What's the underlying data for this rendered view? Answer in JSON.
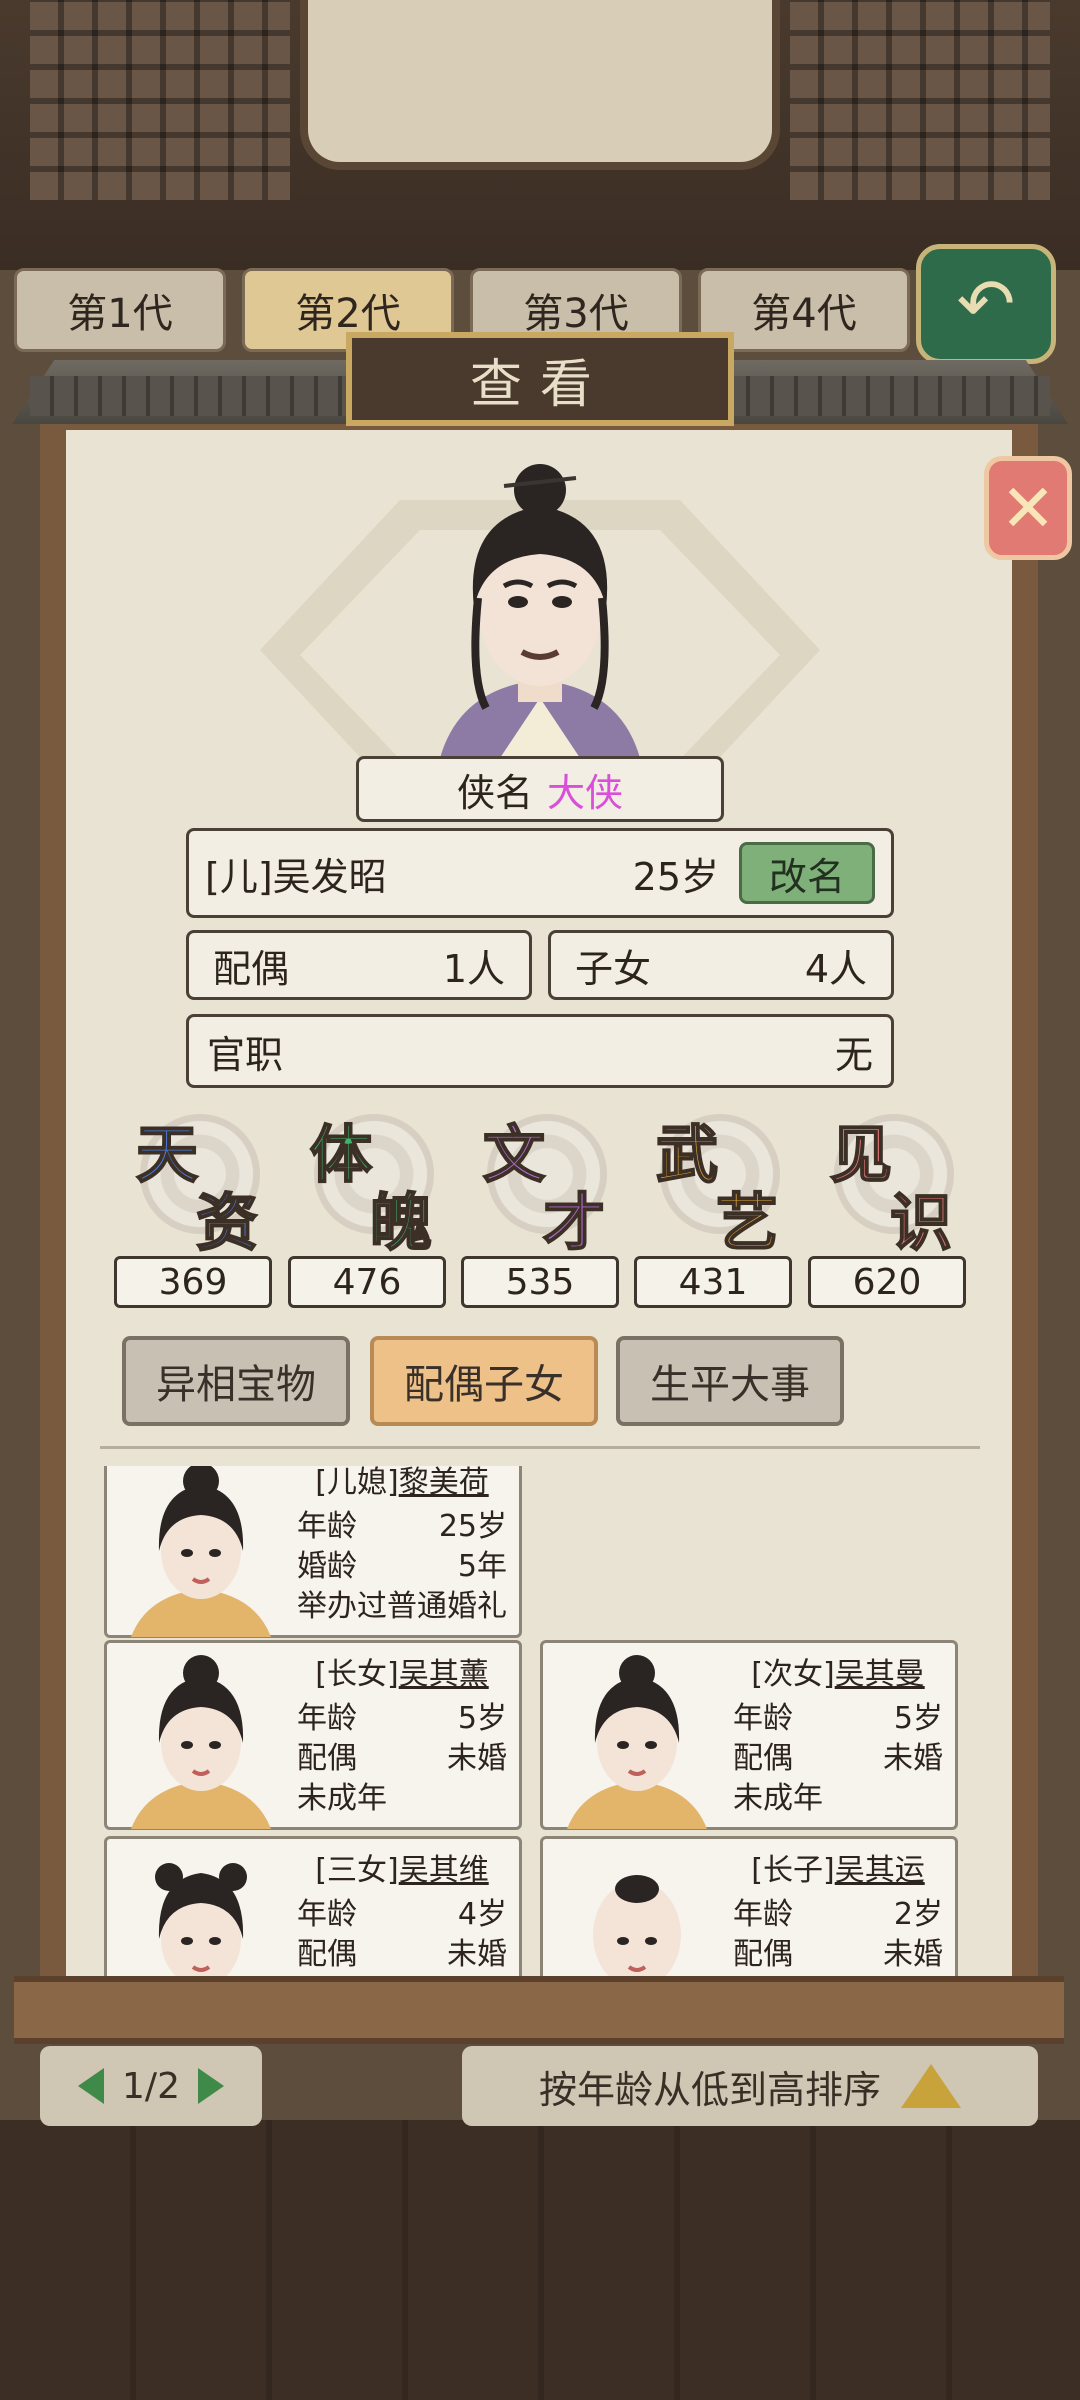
{
  "generation_tabs": [
    "第1代",
    "第2代",
    "第3代",
    "第4代"
  ],
  "dialog_title": "查看",
  "profile": {
    "title_label": "侠名",
    "title_value": "大侠",
    "name": "[儿]吴发昭",
    "age": "25岁",
    "rename_label": "改名",
    "spouse_label": "配偶",
    "spouse_value": "1人",
    "children_label": "子女",
    "children_value": "4人",
    "office_label": "官职",
    "office_value": "无"
  },
  "attributes": [
    {
      "c1": "天",
      "c2": "资",
      "value": "369",
      "color": "#4a7de0"
    },
    {
      "c1": "体",
      "c2": "魄",
      "value": "476",
      "color": "#3fb36b"
    },
    {
      "c1": "文",
      "c2": "才",
      "value": "535",
      "color": "#b56ad8"
    },
    {
      "c1": "武",
      "c2": "艺",
      "value": "431",
      "color": "#e3a63a"
    },
    {
      "c1": "见",
      "c2": "识",
      "value": "620",
      "color": "#e57878"
    }
  ],
  "section_tabs": [
    "异相宝物",
    "配偶子女",
    "生平大事"
  ],
  "members": [
    {
      "prefix": "[儿媳]",
      "name": "黎美荷",
      "r1l": "年龄",
      "r1v": "25岁",
      "r2l": "婚龄",
      "r2v": "5年",
      "note": "举办过普通婚礼"
    },
    {
      "prefix": "[长女]",
      "name": "吴其薰",
      "r1l": "年龄",
      "r1v": "5岁",
      "r2l": "配偶",
      "r2v": "未婚",
      "note": "未成年"
    },
    {
      "prefix": "[次女]",
      "name": "吴其曼",
      "r1l": "年龄",
      "r1v": "5岁",
      "r2l": "配偶",
      "r2v": "未婚",
      "note": "未成年"
    },
    {
      "prefix": "[三女]",
      "name": "吴其维",
      "r1l": "年龄",
      "r1v": "4岁",
      "r2l": "配偶",
      "r2v": "未婚",
      "note": ""
    },
    {
      "prefix": "[长子]",
      "name": "吴其运",
      "r1l": "年龄",
      "r1v": "2岁",
      "r2l": "配偶",
      "r2v": "未婚",
      "note": ""
    }
  ],
  "footer": {
    "page": "1/2",
    "sort_label": "按年龄从低到高排序"
  }
}
